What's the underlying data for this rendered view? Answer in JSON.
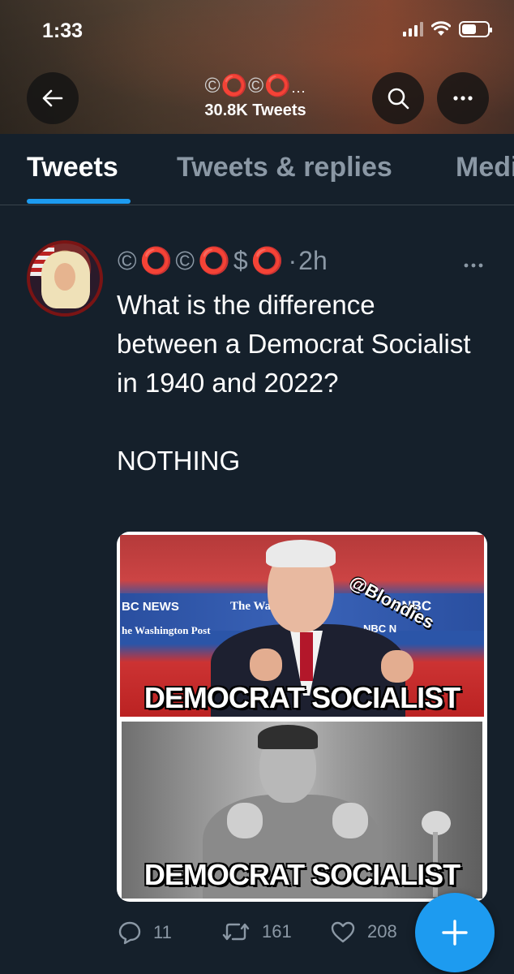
{
  "status_bar": {
    "time": "1:33",
    "icons": [
      "cellular-signal-icon",
      "wifi-icon",
      "battery-icon"
    ],
    "battery_level": 0.55
  },
  "header": {
    "back_icon": "arrow-left-icon",
    "display_name_emoji": [
      "©",
      "⭕",
      "©",
      "⭕"
    ],
    "display_name_ellipsis": "...",
    "tweet_count": "30.8K Tweets",
    "search_icon": "search-icon",
    "more_icon": "more-dots-icon"
  },
  "tabs": [
    {
      "label": "Tweets",
      "active": true
    },
    {
      "label": "Tweets & replies",
      "active": false
    },
    {
      "label": "Media",
      "active": false
    }
  ],
  "tweet": {
    "display_name": [
      "©",
      "⭕",
      "©",
      "⭕",
      "$",
      "⭕"
    ],
    "separator": "·",
    "time": "2h",
    "more_icon": "more-dots-icon",
    "text": "What is the difference between a Democrat Socialist in 1940 and 2022?\n\nNOTHING",
    "media": {
      "watermark": "@Blondies",
      "top_caption": "DEMOCRAT SOCIALIST",
      "bottom_caption": "DEMOCRAT SOCIALIST",
      "banner_texts": [
        "BC NEWS",
        "The Was",
        "he Washington Post",
        "SNBC",
        "NBC N"
      ]
    },
    "actions": {
      "reply_count": "11",
      "retweet_count": "161",
      "like_count": "208"
    }
  },
  "fab": {
    "icon": "compose-plus-icon"
  },
  "colors": {
    "background": "#15202b",
    "accent": "#1d9bf0",
    "muted": "#8b98a5",
    "divider": "#38444d",
    "emoji_red": "#e0262a"
  }
}
